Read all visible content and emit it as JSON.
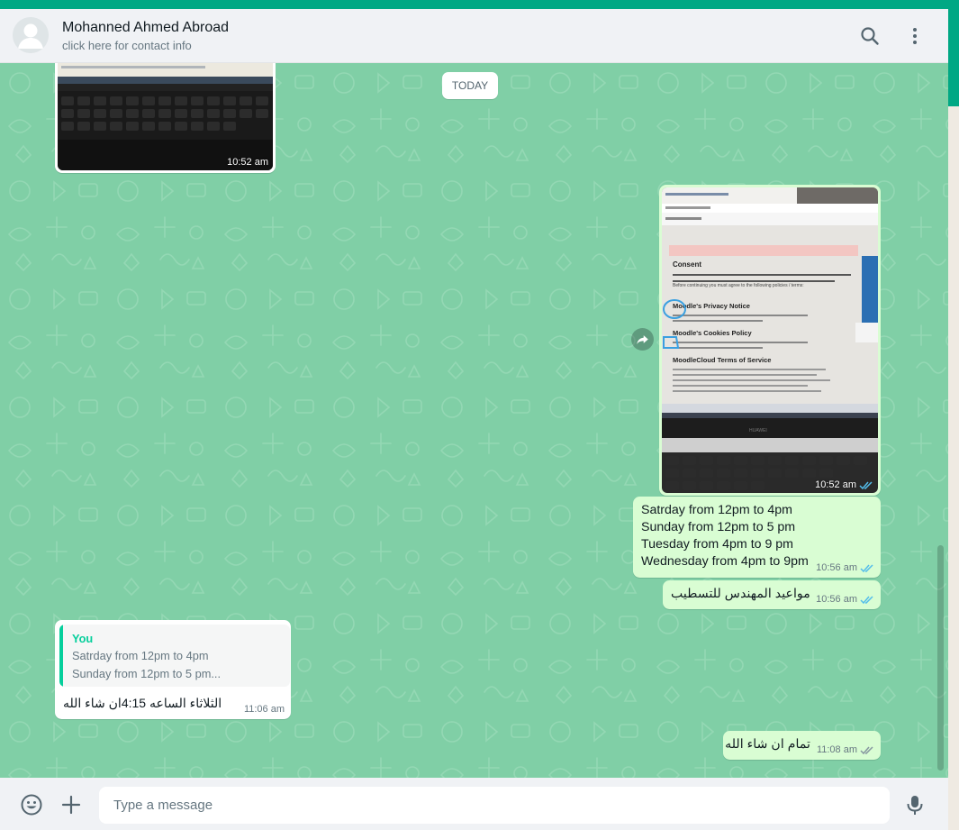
{
  "header": {
    "contact_name": "Mohanned Ahmed Abroad",
    "subtitle": "click here for contact info",
    "icons": [
      "search-icon",
      "menu-icon"
    ]
  },
  "chat": {
    "date_divider": "TODAY",
    "messages": [
      {
        "type": "image",
        "direction": "outgoing",
        "time": "10:52 am",
        "status": "none"
      },
      {
        "type": "image",
        "direction": "outgoing",
        "time": "10:52 am",
        "status": "read",
        "screenshot_text": [
          "Consent",
          "Before continuing you must agree to the following policies / terms:",
          "Moodle's Privacy Notice",
          "Moodle's Cookies Policy",
          "MoodleCloud Terms of Service",
          "HUAWEI"
        ]
      },
      {
        "type": "text",
        "direction": "outgoing",
        "lines": [
          "Satrday from 12pm to 4pm",
          "Sunday from 12pm to 5 pm",
          "Tuesday from 4pm to 9 pm",
          "Wednesday from 4pm to 9pm"
        ],
        "time": "10:56 am",
        "status": "read"
      },
      {
        "type": "text",
        "direction": "outgoing",
        "lines": [
          "مواعيد المهندس للتسطيب"
        ],
        "time": "10:56 am",
        "status": "read"
      },
      {
        "type": "reply",
        "direction": "incoming",
        "quote": {
          "author": "You",
          "lines": [
            "Satrday from 12pm to 4pm",
            "Sunday from 12pm to 5 pm..."
          ]
        },
        "text": "الثلاثاء الساعه 4:15ان شاء الله",
        "time": "11:06 am"
      },
      {
        "type": "text",
        "direction": "outgoing",
        "lines": [
          "تمام ان شاء الله"
        ],
        "time": "11:08 am",
        "status": "read"
      }
    ]
  },
  "footer": {
    "placeholder": "Type a message",
    "icons": [
      "emoji-icon",
      "attach-plus-icon",
      "microphone-icon"
    ]
  },
  "colors": {
    "accent": "#00a884",
    "chat_background": "#80cfa6",
    "outgoing_bubble": "#d9fdd3",
    "incoming_bubble": "#ffffff",
    "read_ticks": "#53bdeb",
    "quote_author": "#06cf9c"
  }
}
